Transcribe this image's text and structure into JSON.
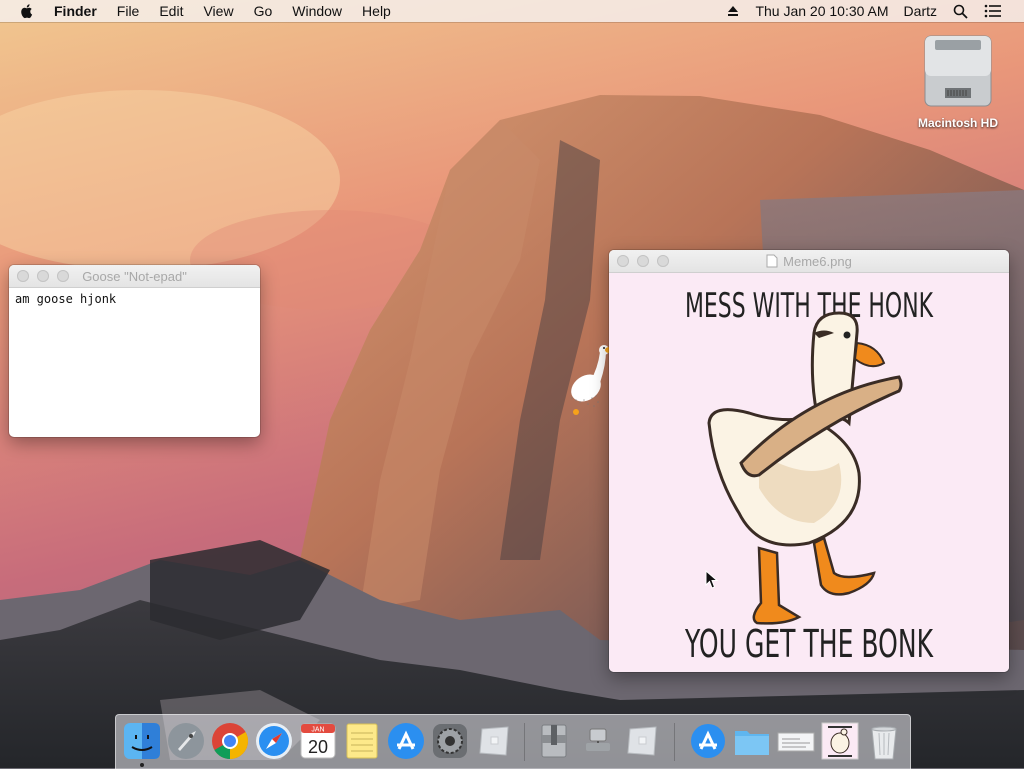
{
  "menubar": {
    "app_name": "Finder",
    "menus": [
      "File",
      "Edit",
      "View",
      "Go",
      "Window",
      "Help"
    ],
    "clock": "Thu Jan 20  10:30 AM",
    "user": "Dartz",
    "icons": [
      "apple-icon",
      "eject-icon",
      "search-icon",
      "notification-list-icon"
    ]
  },
  "desktop": {
    "hd_label": "Macintosh HD"
  },
  "notepad": {
    "title": "Goose \"Not-epad\"",
    "content": "am goose hjonk"
  },
  "preview": {
    "title": "Meme6.png",
    "meme_top": "MESS WITH THE HONK",
    "meme_bottom": "YOU GET THE BONK"
  },
  "dock": {
    "items": [
      "Finder",
      "Launchpad",
      "Chrome",
      "Safari",
      "Calendar",
      "Notes",
      "App Store",
      "System Preferences",
      "Blank App",
      "Archive Utility",
      "Network Utility",
      "Blank App 2",
      "App Store Download",
      "Folder",
      "Document",
      "Meme Preview",
      "Trash"
    ],
    "calendar_month": "JAN",
    "calendar_day": "20"
  },
  "colors": {
    "menubar_bg": "#f5f0ee",
    "notepad_title": "#a8a8a8",
    "meme_bg": "#fbeaf5",
    "goose_beak": "#f08a1c",
    "goose_body": "#fbf3e4"
  }
}
